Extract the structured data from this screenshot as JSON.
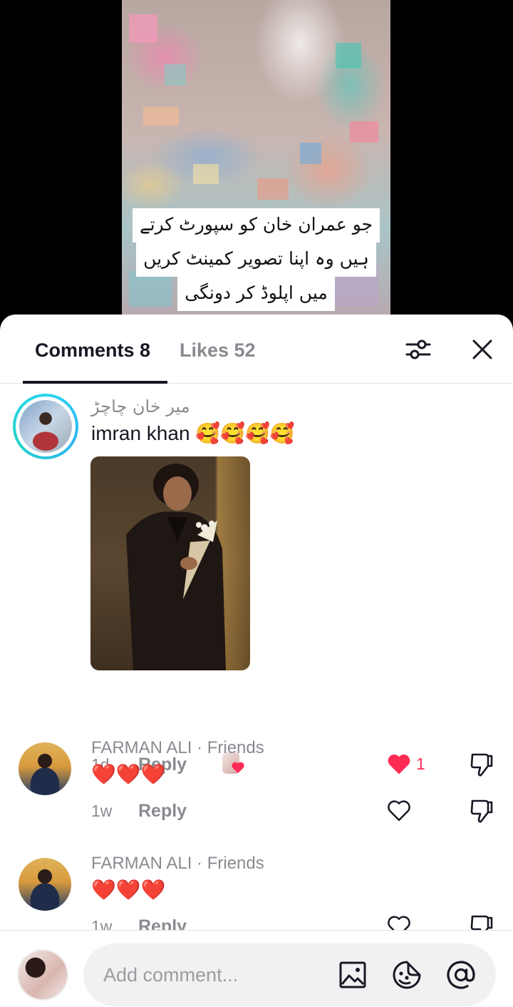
{
  "video": {
    "caption_lines": [
      "جو عمران خان کو سپورٹ کرتے",
      "ہیں وہ اپنا تصویر کمینٹ کریں",
      "میں اپلوڈ کر دونگی"
    ]
  },
  "sheet": {
    "tabs": [
      {
        "label": "Comments 8",
        "active": true
      },
      {
        "label": "Likes 52",
        "active": false
      }
    ],
    "filter_icon": "sliders-icon",
    "close_icon": "close-icon"
  },
  "comments": [
    {
      "username": "میر خان چاچڑ",
      "text": "imran khan 🥰🥰🥰🥰",
      "has_photo": true,
      "time": "1d",
      "reply_label": "Reply",
      "liked": true,
      "like_count": "1"
    },
    {
      "username": "FARMAN ALI · Friends",
      "text": "❤️❤️❤️",
      "time": "1w",
      "reply_label": "Reply",
      "liked": false
    },
    {
      "username": "FARMAN ALI · Friends",
      "text": "❤️❤️❤️",
      "time": "1w",
      "reply_label": "Reply",
      "liked": false
    }
  ],
  "composer": {
    "placeholder": "Add comment...",
    "icons": [
      "image-icon",
      "sticker-icon",
      "mention-icon"
    ]
  },
  "colors": {
    "like_active": "#fe2c55",
    "text_primary": "#161823",
    "text_secondary": "#8a8b91",
    "avatar_ring": "#25d6ee"
  }
}
